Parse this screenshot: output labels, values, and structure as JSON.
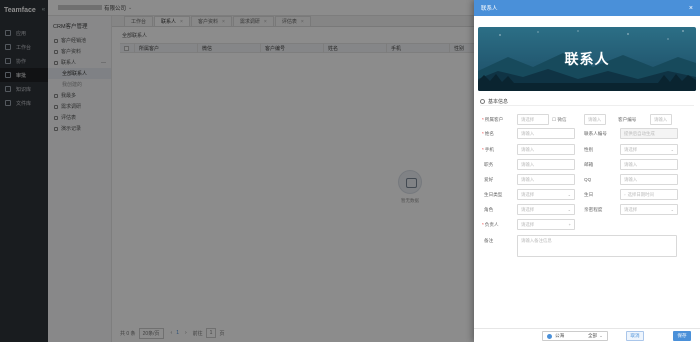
{
  "app": {
    "brand": "Teamface",
    "company_suffix": "有限公司",
    "nav": [
      {
        "label": "应用",
        "icon": "apps-icon"
      },
      {
        "label": "工作台",
        "icon": "workbench-icon"
      },
      {
        "label": "协作",
        "icon": "collaboration-icon"
      },
      {
        "label": "审批",
        "icon": "approval-icon"
      },
      {
        "label": "知识库",
        "icon": "knowledge-icon"
      },
      {
        "label": "文件库",
        "icon": "files-icon"
      }
    ]
  },
  "module": {
    "title": "CRM客户管理",
    "items": [
      {
        "label": "客户经销池"
      },
      {
        "label": "客户资料"
      },
      {
        "label": "联系人",
        "caret": "—"
      },
      {
        "label": "全部联系人",
        "child": true,
        "current": true
      },
      {
        "label": "我创建的",
        "child": true
      },
      {
        "label": "我最多"
      },
      {
        "label": "需求调研"
      },
      {
        "label": "评估表"
      },
      {
        "label": "演示记录"
      }
    ]
  },
  "tabs": [
    {
      "label": "工作台"
    },
    {
      "label": "联系人",
      "close": "×"
    },
    {
      "label": "客户资料",
      "close": "×"
    },
    {
      "label": "需求调研",
      "close": "×"
    },
    {
      "label": "评估表",
      "close": "×"
    }
  ],
  "list": {
    "header": "全部联系人",
    "columns": [
      "所属客户",
      "微信",
      "客户编号",
      "姓名",
      "手机",
      "性别"
    ],
    "empty_text": "暂无数据",
    "pager": {
      "total": "共 0 条",
      "page_size": "20条/页",
      "prev": "‹",
      "page": "1",
      "next": "›",
      "goto": "前往",
      "goto_page": "1",
      "unit": "页"
    }
  },
  "panel": {
    "title": "联系人",
    "close": "×",
    "banner_text": "联系人",
    "section": "基本信息",
    "fields": {
      "customer_label": "所属客户",
      "customer_ph": "请选择",
      "wechat_label": "微信",
      "wechat_ph": "请输入",
      "custno_label": "客户编号",
      "custno_ph": "请输入",
      "name_label": "姓名",
      "name_ph": "请输入",
      "contactno_label": "联系人编号",
      "contactno_ph": "提供后自动生成",
      "mobile_label": "手机",
      "mobile_ph": "请输入",
      "gender_label": "性别",
      "gender_ph": "请选择",
      "job_label": "职务",
      "job_ph": "请输入",
      "email_label": "邮箱",
      "email_ph": "请输入",
      "hobby_label": "爱好",
      "hobby_ph": "请输入",
      "qq_label": "QQ",
      "qq_ph": "请输入",
      "birthtype_label": "生日类型",
      "birthtype_ph": "请选择",
      "birthday_label": "生日",
      "birthday_ph": "选择日期时间",
      "role_label": "角色",
      "role_ph": "请选择",
      "intimacy_label": "亲密程度",
      "intimacy_ph": "请选择",
      "owner_label": "负责人",
      "owner_ph": "请选择",
      "remark_label": "备注",
      "remark_ph": "请输入备注信息"
    },
    "share_label": "公海",
    "share_scope": "全部",
    "cancel": "取消",
    "save": "保存"
  },
  "colors": {
    "accent": "#4a90d9",
    "nav_bg": "#2f3339"
  }
}
